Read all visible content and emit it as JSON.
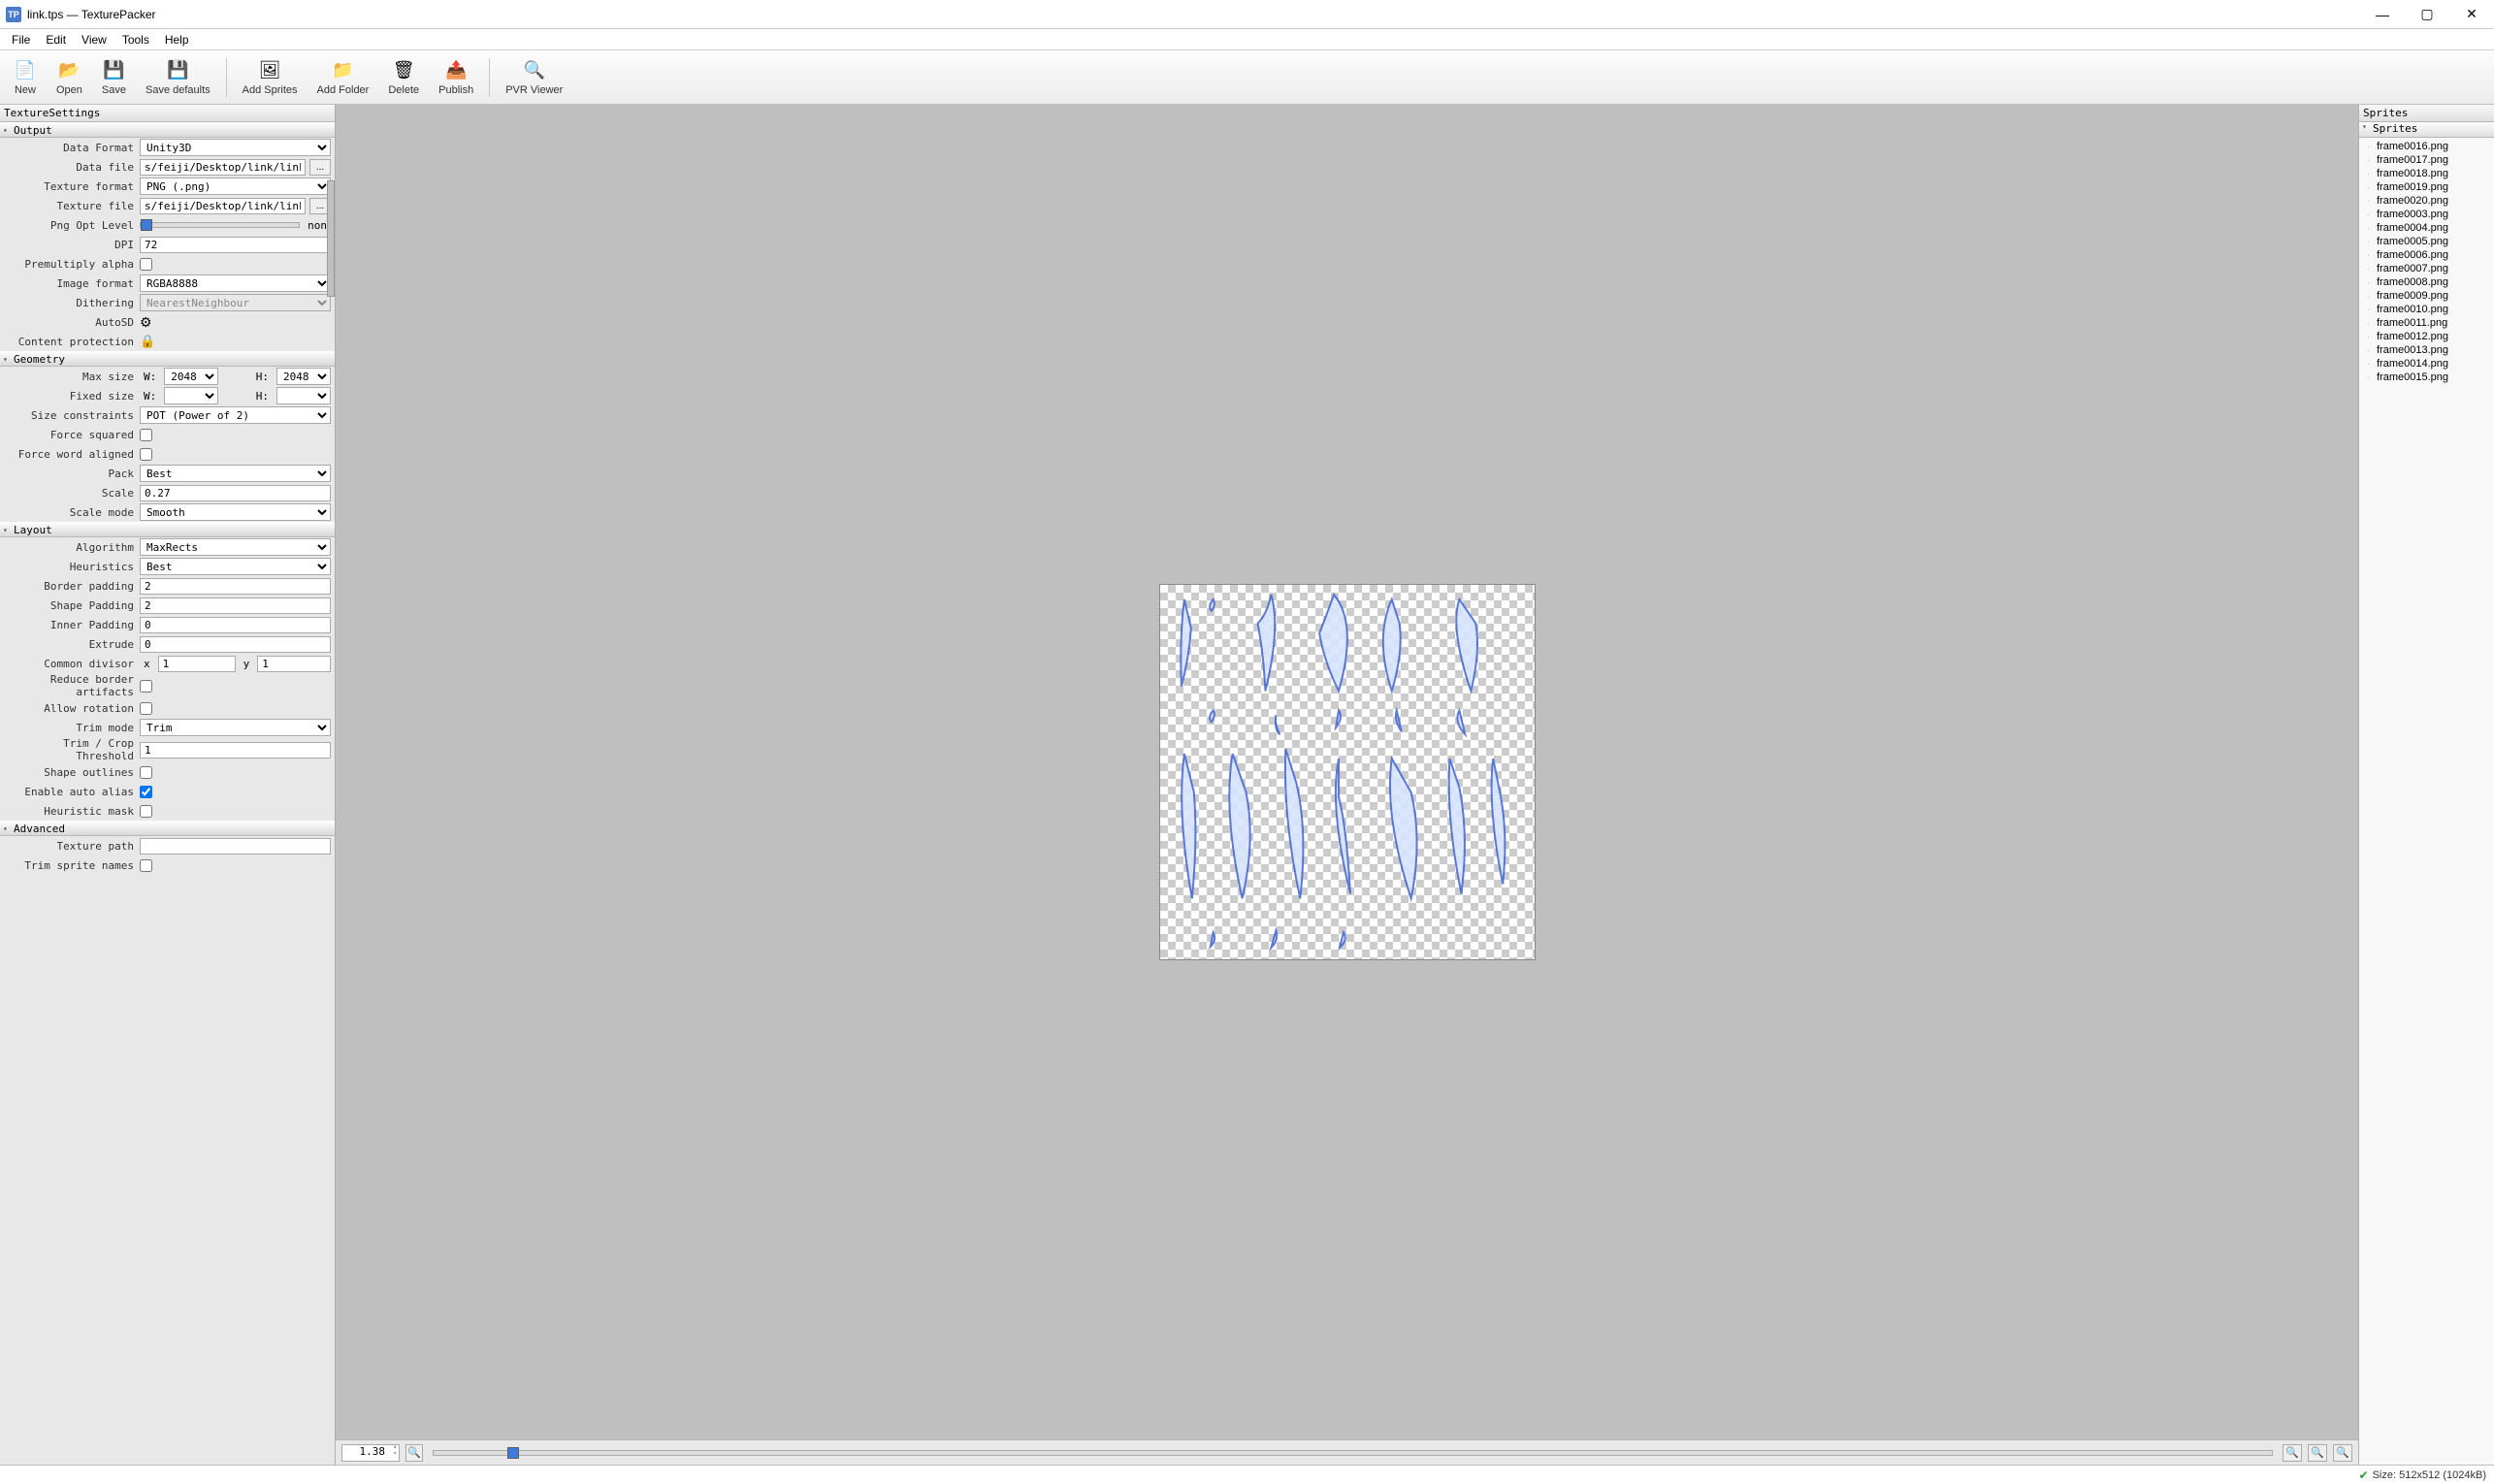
{
  "window": {
    "title": "link.tps — TexturePacker"
  },
  "menubar": [
    "File",
    "Edit",
    "View",
    "Tools",
    "Help"
  ],
  "toolbar": [
    {
      "id": "new",
      "label": "New",
      "icon": "📄"
    },
    {
      "id": "open",
      "label": "Open",
      "icon": "📂"
    },
    {
      "id": "save",
      "label": "Save",
      "icon": "💾"
    },
    {
      "id": "save-defaults",
      "label": "Save defaults",
      "icon": "💾"
    },
    {
      "sep": true
    },
    {
      "id": "add-sprites",
      "label": "Add Sprites",
      "icon": "🖼"
    },
    {
      "id": "add-folder",
      "label": "Add Folder",
      "icon": "📁"
    },
    {
      "id": "delete",
      "label": "Delete",
      "icon": "🗑"
    },
    {
      "id": "publish",
      "label": "Publish",
      "icon": "📤"
    },
    {
      "sep": true
    },
    {
      "id": "pvr-viewer",
      "label": "PVR Viewer",
      "icon": "🔍"
    }
  ],
  "left": {
    "panel_title": "TextureSettings",
    "output": {
      "title": "Output",
      "data_format_lbl": "Data Format",
      "data_format": "Unity3D",
      "data_file_lbl": "Data file",
      "data_file": "s/feiji/Desktop/link/link.txt",
      "texture_format_lbl": "Texture format",
      "texture_format": "PNG (.png)",
      "texture_file_lbl": "Texture file",
      "texture_file": "s/feiji/Desktop/link/link.png",
      "png_opt_lbl": "Png Opt Level",
      "png_opt_hint": "non",
      "dpi_lbl": "DPI",
      "dpi": "72",
      "premult_lbl": "Premultiply alpha",
      "premult": false,
      "imgfmt_lbl": "Image format",
      "imgfmt": "RGBA8888",
      "dither_lbl": "Dithering",
      "dither": "NearestNeighbour",
      "autosd_lbl": "AutoSD",
      "contentprot_lbl": "Content protection"
    },
    "geometry": {
      "title": "Geometry",
      "maxsize_lbl": "Max size",
      "w_lbl": "W:",
      "h_lbl": "H:",
      "maxw": "2048",
      "maxh": "2048",
      "fixedsize_lbl": "Fixed size",
      "fw": "",
      "fh": "",
      "sizeconstraints_lbl": "Size constraints",
      "sizeconstraints": "POT (Power of 2)",
      "forcesq_lbl": "Force squared",
      "forcesq": false,
      "forcewa_lbl": "Force word aligned",
      "forcewa": false,
      "pack_lbl": "Pack",
      "pack": "Best",
      "scale_lbl": "Scale",
      "scale": "0.27",
      "scalemode_lbl": "Scale mode",
      "scalemode": "Smooth"
    },
    "layout": {
      "title": "Layout",
      "algo_lbl": "Algorithm",
      "algo": "MaxRects",
      "heur_lbl": "Heuristics",
      "heur": "Best",
      "borderpad_lbl": "Border padding",
      "borderpad": "2",
      "shapepad_lbl": "Shape Padding",
      "shapepad": "2",
      "innerpad_lbl": "Inner Padding",
      "innerpad": "0",
      "extrude_lbl": "Extrude",
      "extrude": "0",
      "commdiv_lbl": "Common divisor",
      "x_lbl": "x",
      "y_lbl": "y",
      "cdx": "1",
      "cdy": "1",
      "reduce_lbl": "Reduce border artifacts",
      "reduce": false,
      "allowrot_lbl": "Allow rotation",
      "allowrot": false,
      "trimmode_lbl": "Trim mode",
      "trimmode": "Trim",
      "trimthr_lbl": "Trim / Crop Threshold",
      "trimthr": "1",
      "shapeout_lbl": "Shape outlines",
      "shapeout": false,
      "autoalias_lbl": "Enable auto alias",
      "autoalias": true,
      "heurmask_lbl": "Heuristic mask",
      "heurmask": false
    },
    "advanced": {
      "title": "Advanced",
      "texpath_lbl": "Texture path",
      "texpath": "",
      "trimnames_lbl": "Trim sprite names",
      "trimnames": false
    }
  },
  "zoom": {
    "value": "1.38"
  },
  "sprites": {
    "panel_title": "Sprites",
    "tree_title": "Sprites",
    "items": [
      "frame0016.png",
      "frame0017.png",
      "frame0018.png",
      "frame0019.png",
      "frame0020.png",
      "frame0003.png",
      "frame0004.png",
      "frame0005.png",
      "frame0006.png",
      "frame0007.png",
      "frame0008.png",
      "frame0009.png",
      "frame0010.png",
      "frame0011.png",
      "frame0012.png",
      "frame0013.png",
      "frame0014.png",
      "frame0015.png"
    ]
  },
  "status": {
    "text": "Size: 512x512 (1024kB)"
  }
}
